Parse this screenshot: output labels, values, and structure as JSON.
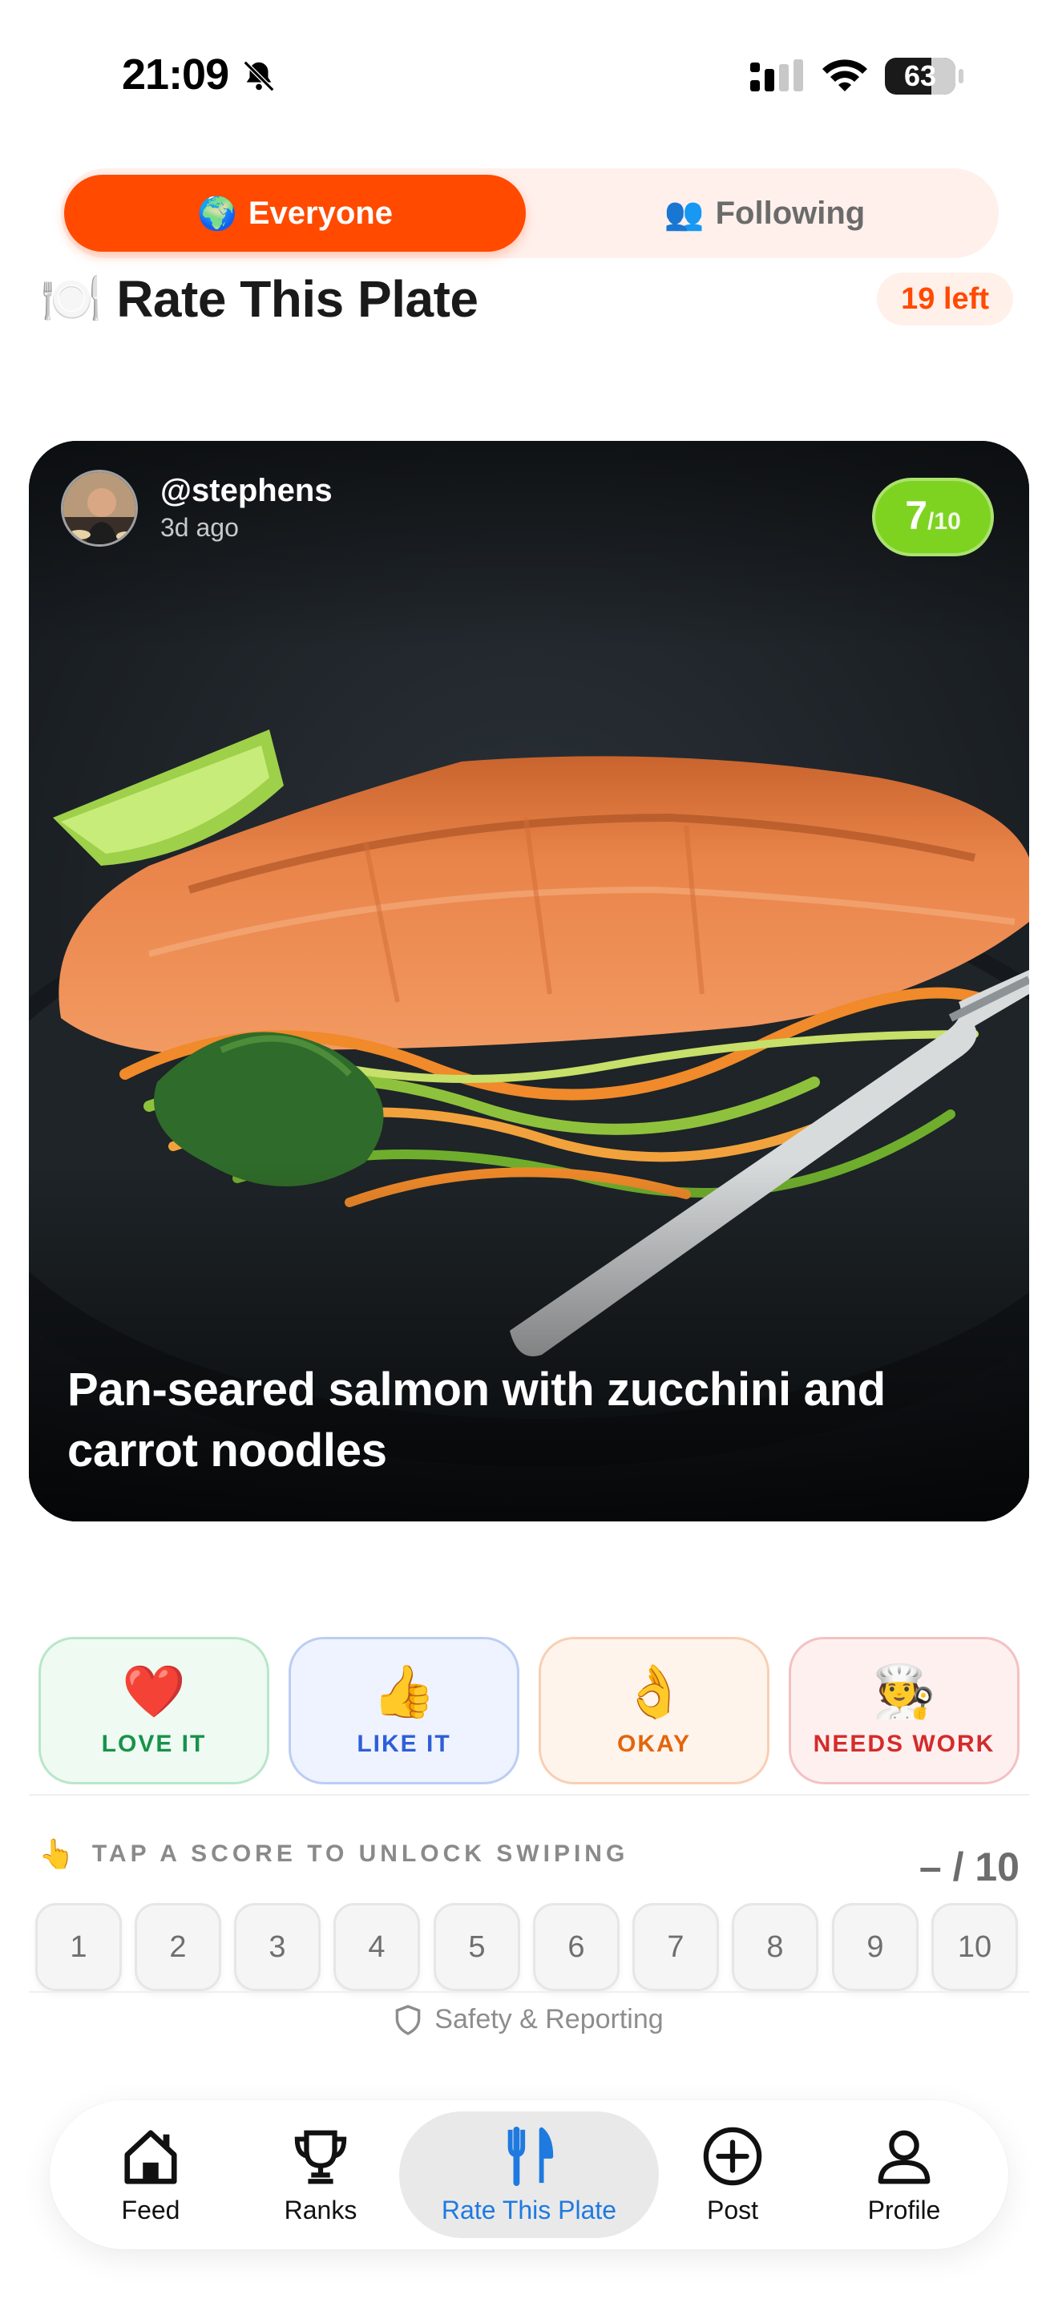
{
  "status_bar": {
    "time": "21:09",
    "battery": "63"
  },
  "feed_toggle": {
    "everyone": {
      "emoji": "🌍",
      "label": "Everyone"
    },
    "following": {
      "emoji": "👥",
      "label": "Following"
    }
  },
  "header": {
    "emoji": "🍽️",
    "title": "Rate This Plate",
    "remaining": "19 left"
  },
  "post": {
    "username": "@stephens",
    "time_ago": "3d ago",
    "score": "7",
    "score_max": "/10",
    "caption": "Pan-seared salmon with zucchini and carrot noodles"
  },
  "reactions": [
    {
      "emoji": "❤️",
      "label": "LOVE IT"
    },
    {
      "emoji": "👍",
      "label": "LIKE IT"
    },
    {
      "emoji": "👌",
      "label": "OKAY"
    },
    {
      "emoji": "🧑‍🍳",
      "label": "NEEDS WORK"
    }
  ],
  "scoring": {
    "hint_emoji": "👆",
    "hint": "TAP A SCORE TO UNLOCK SWIPING",
    "current": "– / 10",
    "options": [
      "1",
      "2",
      "3",
      "4",
      "5",
      "6",
      "7",
      "8",
      "9",
      "10"
    ]
  },
  "safety_link": "Safety & Reporting",
  "tabs": [
    {
      "label": "Feed",
      "icon": "house-icon"
    },
    {
      "label": "Ranks",
      "icon": "trophy-icon"
    },
    {
      "label": "Rate This Plate",
      "icon": "fork-knife-icon",
      "active": true
    },
    {
      "label": "Post",
      "icon": "plus-circle-icon"
    },
    {
      "label": "Profile",
      "icon": "person-icon"
    }
  ],
  "colors": {
    "accent": "#ff4a00",
    "score_badge": "#7ed321",
    "active_tab": "#1f7ae0"
  }
}
